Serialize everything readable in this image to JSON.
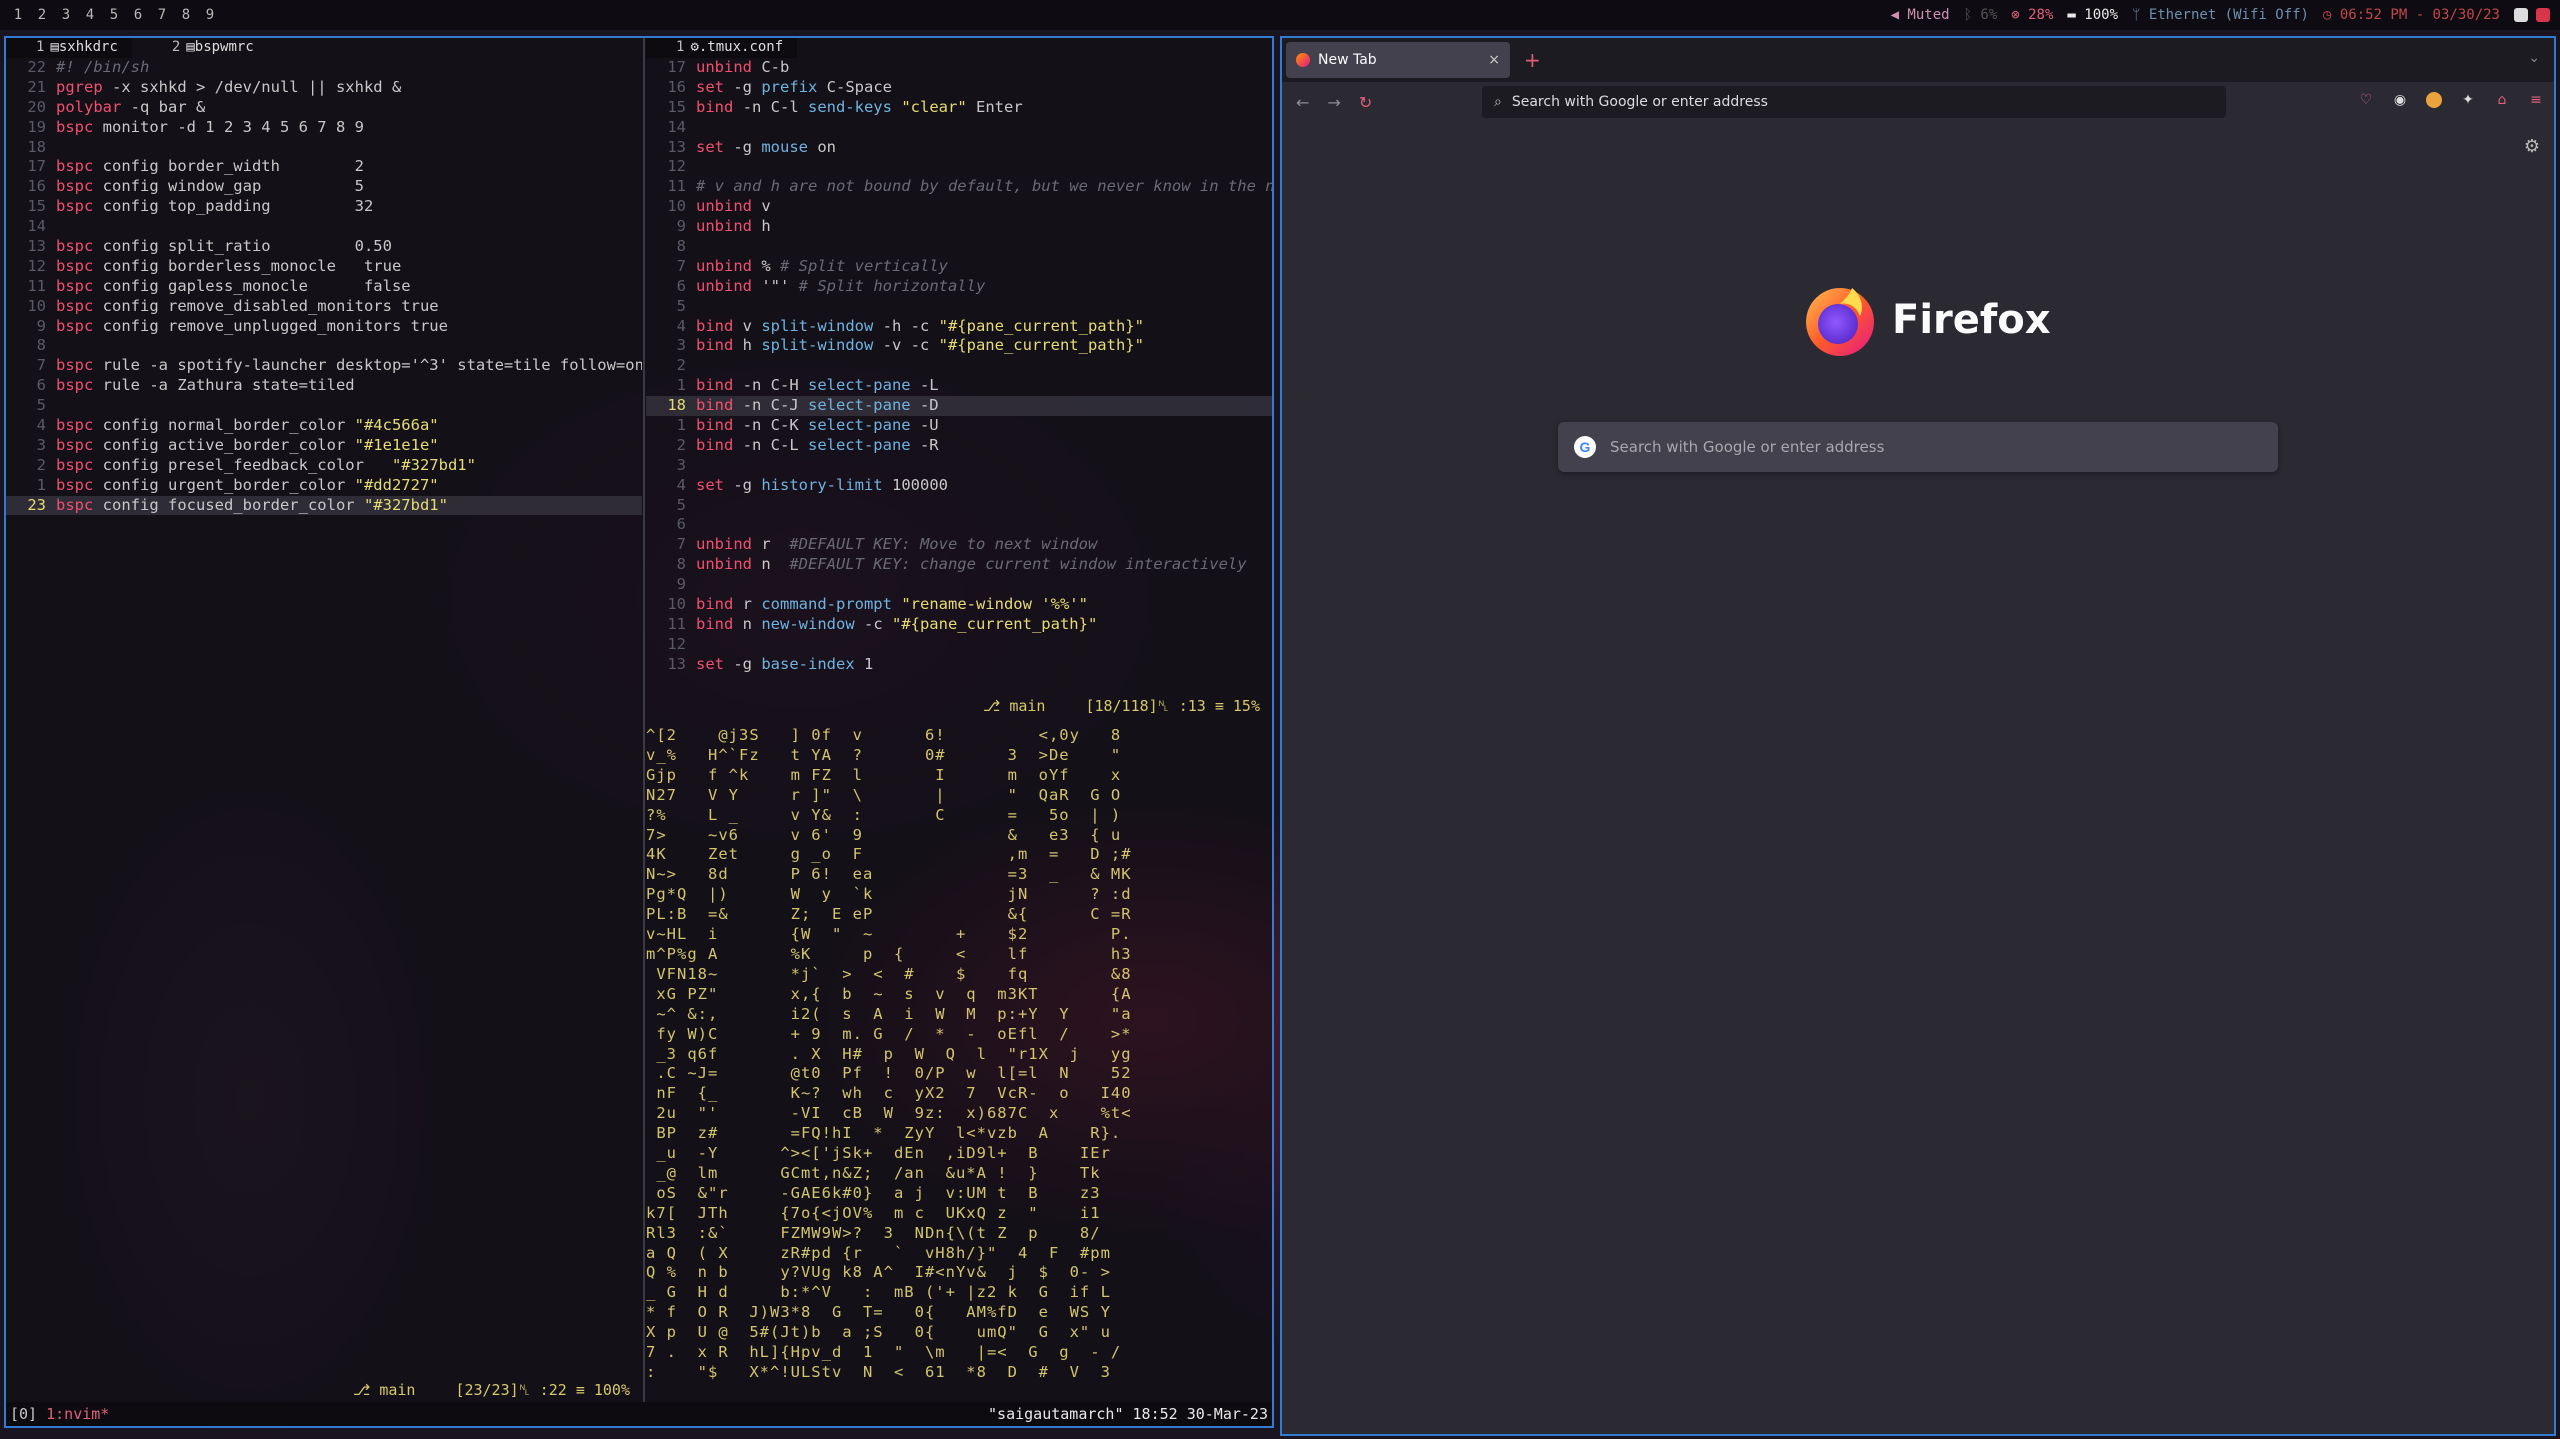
{
  "bar": {
    "workspaces": [
      "1",
      "2",
      "3",
      "4",
      "5",
      "6",
      "7",
      "8",
      "9"
    ],
    "status": {
      "muted": "◀ Muted",
      "brightness": "ᛒ 6%",
      "cpu": "⊗ 28%",
      "battery": "100%",
      "network": "ᛘ Ethernet (Wifi Off)",
      "clock": "◷ 06:52 PM - 03/30/23"
    },
    "colors": {
      "background": "#0e0c12",
      "muted": "#d08fb0",
      "clock": "#c04848",
      "network": "#6a8fb0"
    }
  },
  "terminal": {
    "border_color": "#327bd1",
    "left": {
      "tabs": [
        {
          "num": "1",
          "name": "sxhkdrc"
        },
        {
          "num": "2",
          "name": "bspwmrc"
        }
      ],
      "lines": [
        {
          "n": "22",
          "t": "#! /bin/sh"
        },
        {
          "n": "21",
          "t": "pgrep -x sxhkd > /dev/null || sxhkd &"
        },
        {
          "n": "20",
          "t": "polybar -q bar &"
        },
        {
          "n": "19",
          "t": "bspc monitor -d 1 2 3 4 5 6 7 8 9"
        },
        {
          "n": "18",
          "t": ""
        },
        {
          "n": "17",
          "t": "bspc config border_width        2"
        },
        {
          "n": "16",
          "t": "bspc config window_gap          5"
        },
        {
          "n": "15",
          "t": "bspc config top_padding         32"
        },
        {
          "n": "14",
          "t": ""
        },
        {
          "n": "13",
          "t": "bspc config split_ratio         0.50"
        },
        {
          "n": "12",
          "t": "bspc config borderless_monocle   true"
        },
        {
          "n": "11",
          "t": "bspc config gapless_monocle      false"
        },
        {
          "n": "10",
          "t": "bspc config remove_disabled_monitors true"
        },
        {
          "n": "9",
          "t": "bspc config remove_unplugged_monitors true"
        },
        {
          "n": "8",
          "t": ""
        },
        {
          "n": "7",
          "t": "bspc rule -a spotify-launcher desktop='^3' state=tile follow=on"
        },
        {
          "n": "6",
          "t": "bspc rule -a Zathura state=tiled"
        },
        {
          "n": "5",
          "t": ""
        },
        {
          "n": "4",
          "t": "bspc config normal_border_color \"#4c566a\""
        },
        {
          "n": "3",
          "t": "bspc config active_border_color \"#1e1e1e\""
        },
        {
          "n": "2",
          "t": "bspc config presel_feedback_color   \"#327bd1\""
        },
        {
          "n": "1",
          "t": "bspc config urgent_border_color \"#dd2727\""
        },
        {
          "n": "23",
          "t": "bspc config focused_border_color \"#327bd1\"",
          "current": true
        }
      ],
      "status": {
        "branch": "main",
        "position": "[23/23]␤ :22 ≡ 100%"
      }
    },
    "right": {
      "tab": {
        "num": "1",
        "name": ".tmux.conf"
      },
      "lines": [
        {
          "n": "17",
          "t": "unbind C-b"
        },
        {
          "n": "16",
          "t": "set -g prefix C-Space"
        },
        {
          "n": "15",
          "t": "bind -n C-l send-keys \"clear\" Enter"
        },
        {
          "n": "14",
          "t": ""
        },
        {
          "n": "13",
          "t": "set -g mouse on"
        },
        {
          "n": "12",
          "t": ""
        },
        {
          "n": "11",
          "t": "# v and h are not bound by default, but we never know in the next versio"
        },
        {
          "n": "10",
          "t": "unbind v"
        },
        {
          "n": "9",
          "t": "unbind h"
        },
        {
          "n": "8",
          "t": ""
        },
        {
          "n": "7",
          "t": "unbind % # Split vertically"
        },
        {
          "n": "6",
          "t": "unbind '\"' # Split horizontally"
        },
        {
          "n": "5",
          "t": ""
        },
        {
          "n": "4",
          "t": "bind v split-window -h -c \"#{pane_current_path}\""
        },
        {
          "n": "3",
          "t": "bind h split-window -v -c \"#{pane_current_path}\""
        },
        {
          "n": "2",
          "t": ""
        },
        {
          "n": "1",
          "t": "bind -n C-H select-pane -L"
        },
        {
          "n": "18",
          "t": "bind -n C-J select-pane -D",
          "current": true
        },
        {
          "n": "1",
          "t": "bind -n C-K select-pane -U"
        },
        {
          "n": "2",
          "t": "bind -n C-L select-pane -R"
        },
        {
          "n": "3",
          "t": ""
        },
        {
          "n": "4",
          "t": "set -g history-limit 100000"
        },
        {
          "n": "5",
          "t": ""
        },
        {
          "n": "6",
          "t": ""
        },
        {
          "n": "7",
          "t": "unbind r  #DEFAULT KEY: Move to next window"
        },
        {
          "n": "8",
          "t": "unbind n  #DEFAULT KEY: change current window interactively"
        },
        {
          "n": "9",
          "t": ""
        },
        {
          "n": "10",
          "t": "bind r command-prompt \"rename-window '%%'\""
        },
        {
          "n": "11",
          "t": "bind n new-window -c \"#{pane_current_path}\""
        },
        {
          "n": "12",
          "t": ""
        },
        {
          "n": "13",
          "t": "set -g base-index 1"
        }
      ],
      "status": {
        "branch": "main",
        "position": "[18/118]␤ :13 ≡ 15%"
      }
    },
    "matrix_lines": [
      "^[2    @j3S   ] 0f  v      6!         <,0y   8",
      "v_%   H^`Fz   t YA  ?      0#      3  >De    \"",
      "Gjp   f ^k    m FZ  l       I      m  oYf    x",
      "N27   V Y     r ]\"  \\       |      \"  QaR  G O",
      "?%    L _     v Y&  :       C      =   5o  | )",
      "7>    ~v6     v 6'  9              &   e3  { u",
      "4K    Zet     g _o  F              ,m  =   D ;#",
      "N~>   8d      P 6!  ea             =3  _   & MK",
      "Pg*Q  |)      W  y  `k             jN      ? :d",
      "PL:B  =&      Z;  E eP             &{      C =R",
      "v~HL  i       {W  \"  ~        +    $2        P.",
      "m^P%g A       %K     p  {     <    lf        h3",
      " VFN18~       *j`  >  <  #    $    fq        &8",
      " xG PZ\"       x,{  b  ~  s  v  q  m3KT       {A",
      " ~^ &:,       i2(  s  A  i  W  M  p:+Y  Y    \"a",
      " fy W)C       + 9  m. G  /  *  -  oEfl  /    >*",
      " _3 q6f       . X  H#  p  W  Q  l  \"r1X  j   yg",
      " .C ~J=       @t0  Pf  !  0/P  w  l[=l  N    52",
      " nF  {_       K~?  wh  c  yX2  7  VcR-  o   I40",
      " 2u  \"'       -VI  cB  W  9z:  x)687C  x    %t<",
      " BP  z#       =FQ!hI  *  ZyY  l<*vzb  A    R}.",
      " _u  -Y      ^><['jSk+  dEn  ,iD9l+  B    IEr",
      " _@  lm      GCmt,n&Z;  /an  &u*A !  }    Tk",
      " oS  &\"r     -GAE6k#0}  a j  v:UM t  B    z3",
      "k7[  JTh     {7o{<jOV%  m c  UKxQ z  \"    i1",
      "Rl3  :&`     FZMW9W>?  3  NDn{\\(t Z  p    8/",
      "a Q  ( X     zR#pd {r   `  vH8h/}\"  4  F  #pm",
      "Q %  n b     y?VUg k8 A^  I#<nYv&  j  $  0- >",
      "_ G  H d     b:*^V   :  mB ('+ |z2 k  G  if L",
      "* f  O R  J)W3*8  G  T=   0{   AM%fD  e  WS Y",
      "X p  U @  5#(Jt)b  a ;S   0{    umQ\"  G  x\" u",
      "7 .  x R  hL]{Hpv_d  1  \"  \\m   |=<  G  g  - /",
      ":    \"$   X*^!ULStv  N  <  61  *8  D  #  V  3"
    ],
    "tmux": {
      "session": "[0]",
      "window": "1:nvim*",
      "right": "\"saigautamarch\" 18:52 30-Mar-23"
    }
  },
  "firefox": {
    "tab_label": "New Tab",
    "tab_close": "×",
    "new_tab": "+",
    "list_tabs": "⌄",
    "nav": {
      "back": "←",
      "forward": "→",
      "reload": "↻"
    },
    "url_placeholder": "Search with Google or enter address",
    "brand": "Firefox",
    "search_placeholder": "Search with Google or enter address",
    "google_glyph": "G",
    "settings": "⚙",
    "colors": {
      "chrome": "#1c1b22",
      "page": "#2b2a33",
      "field": "#42414d"
    }
  }
}
